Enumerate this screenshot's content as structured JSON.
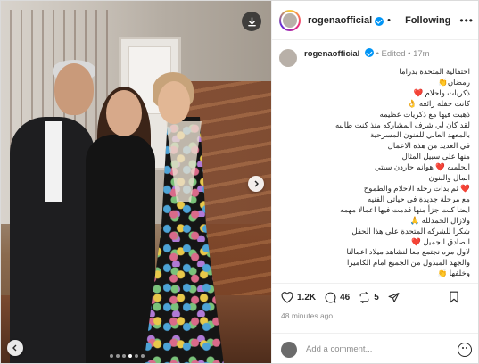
{
  "post": {
    "username": "rogenaofficial",
    "separator": "•",
    "follow_label": "Following",
    "more_label": "•••"
  },
  "caption": {
    "username": "rogenaofficial",
    "edited": "Edited",
    "time": "17m",
    "lines": [
      "احتفالية المتحدة بدراما",
      "رمضان👏",
      "ذكريات واحلام ❤️",
      "كانت حفله رائعه 👌",
      "ذهبت فيها مع ذكريات عظيمه",
      "لقد كان لي شرف المشاركه منذ كنت طالبه",
      "بالمعهد العالي للفنون المسرحية",
      "في العديد من هذه الاعمال",
      "منها على سبيل المثال",
      "الحلميه ❤️ هوانم جاردن سيتي",
      "المال والبنون",
      "❤️ ثم بدات رحله الاحلام والطموح",
      "مع مرحلة جديدة فى حياتى الفنيه",
      "ايضا كنت جزأ منها قدمت فيها اعمالا مهمه",
      "ولازال الحمدلله 🙏",
      "شكرا للشركه المتحدة على هذا الحفل",
      "الصادق الجميل ❤️",
      "لاول مره نجتمع معا لنشاهد ميلاد اعمالنا",
      "والجهد المبذول من الجميع امام الكاميرا",
      "وخلفها 👏",
      "..."
    ]
  },
  "actions": {
    "likes": "1.2K",
    "comments": "46",
    "shares": "5"
  },
  "time_ago": "48 minutes ago",
  "comment": {
    "placeholder": "Add a comment..."
  },
  "carousel": {
    "dots": 6,
    "active_index": 3
  }
}
